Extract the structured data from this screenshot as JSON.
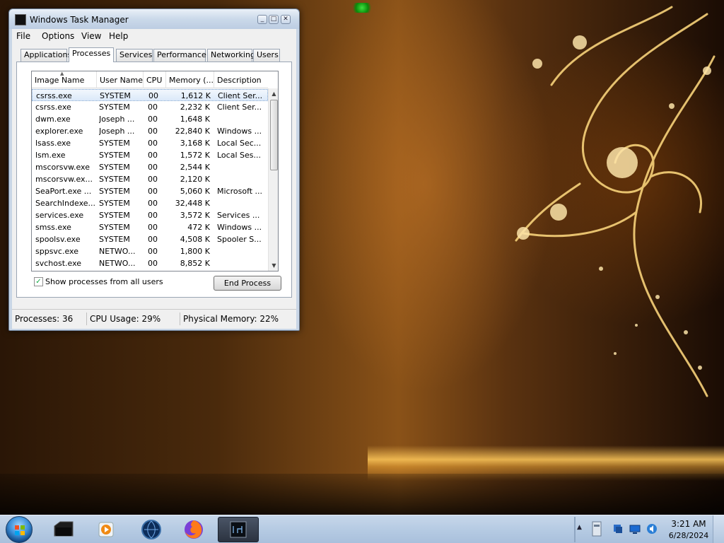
{
  "window": {
    "title": "Windows Task Manager",
    "controls": {
      "minimize": "_",
      "maximize": "□",
      "close": "✕"
    }
  },
  "menu": [
    "File",
    "Options",
    "View",
    "Help"
  ],
  "tabs": [
    "Applications",
    "Processes",
    "Services",
    "Performance",
    "Networking",
    "Users"
  ],
  "active_tab": "Processes",
  "columns": [
    "Image Name",
    "User Name",
    "CPU",
    "Memory (...",
    "Description"
  ],
  "processes": [
    {
      "name": "csrss.exe",
      "user": "SYSTEM",
      "cpu": "00",
      "mem": "1,612 K",
      "desc": "Client Ser..."
    },
    {
      "name": "csrss.exe",
      "user": "SYSTEM",
      "cpu": "00",
      "mem": "2,232 K",
      "desc": "Client Ser..."
    },
    {
      "name": "dwm.exe",
      "user": "Joseph ...",
      "cpu": "00",
      "mem": "1,648 K",
      "desc": ""
    },
    {
      "name": "explorer.exe",
      "user": "Joseph ...",
      "cpu": "00",
      "mem": "22,840 K",
      "desc": "Windows ..."
    },
    {
      "name": "lsass.exe",
      "user": "SYSTEM",
      "cpu": "00",
      "mem": "3,168 K",
      "desc": "Local Sec..."
    },
    {
      "name": "lsm.exe",
      "user": "SYSTEM",
      "cpu": "00",
      "mem": "1,572 K",
      "desc": "Local Ses..."
    },
    {
      "name": "mscorsvw.exe",
      "user": "SYSTEM",
      "cpu": "00",
      "mem": "2,544 K",
      "desc": ""
    },
    {
      "name": "mscorsvw.ex...",
      "user": "SYSTEM",
      "cpu": "00",
      "mem": "2,120 K",
      "desc": ""
    },
    {
      "name": "SeaPort.exe ...",
      "user": "SYSTEM",
      "cpu": "00",
      "mem": "5,060 K",
      "desc": "Microsoft ..."
    },
    {
      "name": "SearchIndexe...",
      "user": "SYSTEM",
      "cpu": "00",
      "mem": "32,448 K",
      "desc": ""
    },
    {
      "name": "services.exe",
      "user": "SYSTEM",
      "cpu": "00",
      "mem": "3,572 K",
      "desc": "Services ..."
    },
    {
      "name": "smss.exe",
      "user": "SYSTEM",
      "cpu": "00",
      "mem": "472 K",
      "desc": "Windows ..."
    },
    {
      "name": "spoolsv.exe",
      "user": "SYSTEM",
      "cpu": "00",
      "mem": "4,508 K",
      "desc": "Spooler S..."
    },
    {
      "name": "sppsvc.exe",
      "user": "NETWO...",
      "cpu": "00",
      "mem": "1,800 K",
      "desc": ""
    },
    {
      "name": "svchost.exe",
      "user": "NETWO...",
      "cpu": "00",
      "mem": "8,852 K",
      "desc": ""
    }
  ],
  "selected_row": 0,
  "show_all_label": "Show processes from all users",
  "show_all_checked": true,
  "end_process_label": "End Process",
  "status": {
    "processes": "Processes: 36",
    "cpu": "CPU Usage: 29%",
    "memory": "Physical Memory: 22%"
  },
  "taskbar": {
    "icons": [
      "media-player-icon",
      "globe-browser-icon",
      "firefox-icon",
      "task-manager-icon"
    ],
    "time": "3:21 AM",
    "date": "6/28/2024"
  },
  "colors": {
    "selection": "#dbe9f9",
    "taskbar": "#b6cbe3",
    "wallpaper_gold": "#f2c25a"
  }
}
